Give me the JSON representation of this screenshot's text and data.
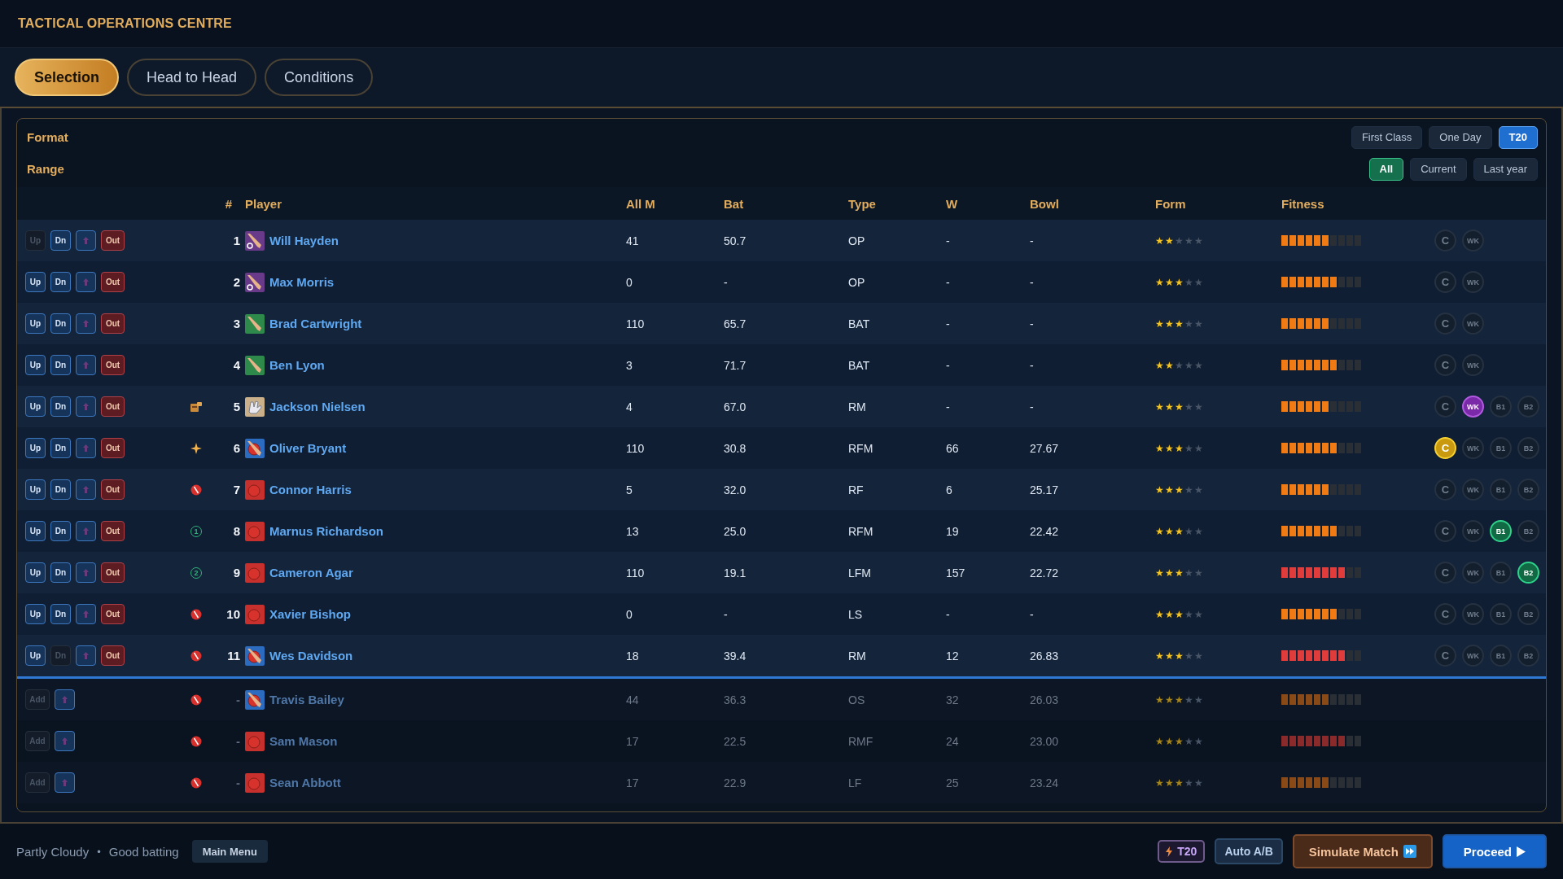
{
  "window": {
    "title": "TACTICAL OPERATIONS CENTRE"
  },
  "tabs": [
    {
      "label": "Selection",
      "selected": true
    },
    {
      "label": "Head to Head",
      "selected": false
    },
    {
      "label": "Conditions",
      "selected": false
    }
  ],
  "filters": [
    {
      "label": "Format",
      "options": [
        {
          "label": "First Class",
          "selected": false
        },
        {
          "label": "One Day",
          "selected": false
        },
        {
          "label": "T20",
          "selected": true
        }
      ],
      "kind": "format"
    },
    {
      "label": "Range",
      "options": [
        {
          "label": "All",
          "selected": true
        },
        {
          "label": "Current",
          "selected": false
        },
        {
          "label": "Last year",
          "selected": false
        }
      ],
      "kind": "range"
    }
  ],
  "table": {
    "columns": [
      "#",
      "Player",
      "All M",
      "Bat",
      "Type",
      "W",
      "Bowl",
      "Form",
      "Fitness"
    ],
    "rows": [
      {
        "kind": "playing",
        "controls": [
          {
            "kind": "up",
            "label": "Up",
            "disabled": true
          },
          {
            "kind": "down",
            "label": "Dn",
            "disabled": false
          },
          {
            "kind": "swap",
            "disabled": false
          },
          {
            "kind": "out",
            "label": "Out",
            "disabled": false
          }
        ],
        "number": "1",
        "role_icon": {
          "kind": "opener"
        },
        "name": "Will Hayden",
        "all_m": "41",
        "bat": "50.7",
        "type": "OP",
        "w": "-",
        "bowl": "-",
        "stars": 2,
        "level": 0.6,
        "roles": [
          {
            "kind": "captain",
            "label": "C",
            "selected": false
          },
          {
            "kind": "keeper",
            "label": "WK",
            "selected": false
          }
        ]
      },
      {
        "kind": "playing",
        "controls": [
          {
            "kind": "up",
            "label": "Up",
            "disabled": false
          },
          {
            "kind": "down",
            "label": "Dn",
            "disabled": false
          },
          {
            "kind": "swap",
            "disabled": false
          },
          {
            "kind": "out",
            "label": "Out",
            "disabled": false
          }
        ],
        "number": "2",
        "role_icon": {
          "kind": "opener"
        },
        "name": "Max Morris",
        "all_m": "0",
        "bat": "-",
        "type": "OP",
        "w": "-",
        "bowl": "-",
        "stars": 3,
        "level": 0.7,
        "roles": [
          {
            "kind": "captain",
            "label": "C",
            "selected": false
          },
          {
            "kind": "keeper",
            "label": "WK",
            "selected": false
          }
        ]
      },
      {
        "kind": "playing",
        "controls": [
          {
            "kind": "up",
            "label": "Up",
            "disabled": false
          },
          {
            "kind": "down",
            "label": "Dn",
            "disabled": false
          },
          {
            "kind": "swap",
            "disabled": false
          },
          {
            "kind": "out",
            "label": "Out",
            "disabled": false
          }
        ],
        "number": "3",
        "role_icon": {
          "kind": "batter"
        },
        "name": "Brad Cartwright",
        "all_m": "110",
        "bat": "65.7",
        "type": "BAT",
        "w": "-",
        "bowl": "-",
        "stars": 3,
        "level": 0.6,
        "roles": [
          {
            "kind": "captain",
            "label": "C",
            "selected": false
          },
          {
            "kind": "keeper",
            "label": "WK",
            "selected": false
          }
        ]
      },
      {
        "kind": "playing",
        "controls": [
          {
            "kind": "up",
            "label": "Up",
            "disabled": false
          },
          {
            "kind": "down",
            "label": "Dn",
            "disabled": false
          },
          {
            "kind": "swap",
            "disabled": false
          },
          {
            "kind": "out",
            "label": "Out",
            "disabled": false
          }
        ],
        "number": "4",
        "role_icon": {
          "kind": "batter"
        },
        "name": "Ben Lyon",
        "all_m": "3",
        "bat": "71.7",
        "type": "BAT",
        "w": "-",
        "bowl": "-",
        "stars": 2,
        "level": 0.7,
        "roles": [
          {
            "kind": "captain",
            "label": "C",
            "selected": false
          },
          {
            "kind": "keeper",
            "label": "WK",
            "selected": false
          }
        ]
      },
      {
        "kind": "playing",
        "controls": [
          {
            "kind": "up",
            "label": "Up",
            "disabled": false
          },
          {
            "kind": "down",
            "label": "Dn",
            "disabled": false
          },
          {
            "kind": "swap",
            "disabled": false
          },
          {
            "kind": "out",
            "label": "Out",
            "disabled": false
          }
        ],
        "marker": {
          "kind": "gloves"
        },
        "number": "5",
        "role_icon": {
          "kind": "keeper"
        },
        "name": "Jackson Nielsen",
        "all_m": "4",
        "bat": "67.0",
        "type": "RM",
        "w": "-",
        "bowl": "-",
        "stars": 3,
        "level": 0.6,
        "roles": [
          {
            "kind": "captain",
            "label": "C",
            "selected": false
          },
          {
            "kind": "keeper",
            "label": "WK",
            "selected": true
          },
          {
            "kind": "bowler",
            "label": "B1",
            "selected": false
          },
          {
            "kind": "bowler",
            "label": "B2",
            "selected": false
          }
        ]
      },
      {
        "kind": "playing",
        "controls": [
          {
            "kind": "up",
            "label": "Up",
            "disabled": false
          },
          {
            "kind": "down",
            "label": "Dn",
            "disabled": false
          },
          {
            "kind": "swap",
            "disabled": false
          },
          {
            "kind": "out",
            "label": "Out",
            "disabled": false
          }
        ],
        "marker": {
          "kind": "spark"
        },
        "number": "6",
        "role_icon": {
          "kind": "allrounder"
        },
        "name": "Oliver Bryant",
        "all_m": "110",
        "bat": "30.8",
        "type": "RFM",
        "w": "66",
        "bowl": "27.67",
        "stars": 3,
        "level": 0.7,
        "roles": [
          {
            "kind": "captain",
            "label": "C",
            "selected": true
          },
          {
            "kind": "keeper",
            "label": "WK",
            "selected": false
          },
          {
            "kind": "bowler",
            "label": "B1",
            "selected": false
          },
          {
            "kind": "bowler",
            "label": "B2",
            "selected": false
          }
        ]
      },
      {
        "kind": "playing",
        "controls": [
          {
            "kind": "up",
            "label": "Up",
            "disabled": false
          },
          {
            "kind": "down",
            "label": "Dn",
            "disabled": false
          },
          {
            "kind": "swap",
            "disabled": false
          },
          {
            "kind": "out",
            "label": "Out",
            "disabled": false
          }
        ],
        "marker": {
          "kind": "ball"
        },
        "number": "7",
        "role_icon": {
          "kind": "bowler"
        },
        "name": "Connor Harris",
        "all_m": "5",
        "bat": "32.0",
        "type": "RF",
        "w": "6",
        "bowl": "25.17",
        "stars": 3,
        "level": 0.6,
        "roles": [
          {
            "kind": "captain",
            "label": "C",
            "selected": false
          },
          {
            "kind": "keeper",
            "label": "WK",
            "selected": false
          },
          {
            "kind": "bowler",
            "label": "B1",
            "selected": false
          },
          {
            "kind": "bowler",
            "label": "B2",
            "selected": false
          }
        ]
      },
      {
        "kind": "playing",
        "controls": [
          {
            "kind": "up",
            "label": "Up",
            "disabled": false
          },
          {
            "kind": "down",
            "label": "Dn",
            "disabled": false
          },
          {
            "kind": "swap",
            "disabled": false
          },
          {
            "kind": "out",
            "label": "Out",
            "disabled": false
          }
        ],
        "marker": {
          "kind": "order",
          "label": "1"
        },
        "number": "8",
        "role_icon": {
          "kind": "bowler"
        },
        "name": "Marnus Richardson",
        "all_m": "13",
        "bat": "25.0",
        "type": "RFM",
        "w": "19",
        "bowl": "22.42",
        "stars": 3,
        "level": 0.7,
        "roles": [
          {
            "kind": "captain",
            "label": "C",
            "selected": false
          },
          {
            "kind": "keeper",
            "label": "WK",
            "selected": false
          },
          {
            "kind": "bowler",
            "label": "B1",
            "selected": true
          },
          {
            "kind": "bowler",
            "label": "B2",
            "selected": false
          }
        ]
      },
      {
        "kind": "playing",
        "controls": [
          {
            "kind": "up",
            "label": "Up",
            "disabled": false
          },
          {
            "kind": "down",
            "label": "Dn",
            "disabled": false
          },
          {
            "kind": "swap",
            "disabled": false
          },
          {
            "kind": "out",
            "label": "Out",
            "disabled": false
          }
        ],
        "marker": {
          "kind": "order",
          "label": "2"
        },
        "number": "9",
        "role_icon": {
          "kind": "bowler"
        },
        "name": "Cameron Agar",
        "all_m": "110",
        "bat": "19.1",
        "type": "LFM",
        "w": "157",
        "bowl": "22.72",
        "stars": 3,
        "level": 0.8,
        "roles": [
          {
            "kind": "captain",
            "label": "C",
            "selected": false
          },
          {
            "kind": "keeper",
            "label": "WK",
            "selected": false
          },
          {
            "kind": "bowler",
            "label": "B1",
            "selected": false
          },
          {
            "kind": "bowler",
            "label": "B2",
            "selected": true
          }
        ]
      },
      {
        "kind": "playing",
        "controls": [
          {
            "kind": "up",
            "label": "Up",
            "disabled": false
          },
          {
            "kind": "down",
            "label": "Dn",
            "disabled": false
          },
          {
            "kind": "swap",
            "disabled": false
          },
          {
            "kind": "out",
            "label": "Out",
            "disabled": false
          }
        ],
        "marker": {
          "kind": "ball"
        },
        "number": "10",
        "role_icon": {
          "kind": "bowler"
        },
        "name": "Xavier Bishop",
        "all_m": "0",
        "bat": "-",
        "type": "LS",
        "w": "-",
        "bowl": "-",
        "stars": 3,
        "level": 0.7,
        "roles": [
          {
            "kind": "captain",
            "label": "C",
            "selected": false
          },
          {
            "kind": "keeper",
            "label": "WK",
            "selected": false
          },
          {
            "kind": "bowler",
            "label": "B1",
            "selected": false
          },
          {
            "kind": "bowler",
            "label": "B2",
            "selected": false
          }
        ]
      },
      {
        "kind": "playing",
        "controls": [
          {
            "kind": "up",
            "label": "Up",
            "disabled": false
          },
          {
            "kind": "down",
            "label": "Dn",
            "disabled": true
          },
          {
            "kind": "swap",
            "disabled": false
          },
          {
            "kind": "out",
            "label": "Out",
            "disabled": false
          }
        ],
        "marker": {
          "kind": "ball"
        },
        "number": "11",
        "role_icon": {
          "kind": "allrounder"
        },
        "name": "Wes Davidson",
        "all_m": "18",
        "bat": "39.4",
        "type": "RM",
        "w": "12",
        "bowl": "26.83",
        "stars": 3,
        "level": 0.8,
        "roles": [
          {
            "kind": "captain",
            "label": "C",
            "selected": false
          },
          {
            "kind": "keeper",
            "label": "WK",
            "selected": false
          },
          {
            "kind": "bowler",
            "label": "B1",
            "selected": false
          },
          {
            "kind": "bowler",
            "label": "B2",
            "selected": false
          }
        ]
      },
      {
        "kind": "bench",
        "controls": [
          {
            "kind": "add",
            "label": "Add",
            "disabled": true
          },
          {
            "kind": "swap",
            "disabled": false
          }
        ],
        "marker": {
          "kind": "ball"
        },
        "number": "-",
        "role_icon": {
          "kind": "allrounder"
        },
        "name": "Travis Bailey",
        "all_m": "44",
        "bat": "36.3",
        "type": "OS",
        "w": "32",
        "bowl": "26.03",
        "stars": 3,
        "level": 0.6
      },
      {
        "kind": "bench",
        "controls": [
          {
            "kind": "add",
            "label": "Add",
            "disabled": true
          },
          {
            "kind": "swap",
            "disabled": false
          }
        ],
        "marker": {
          "kind": "ball"
        },
        "number": "-",
        "role_icon": {
          "kind": "bowler"
        },
        "name": "Sam Mason",
        "all_m": "17",
        "bat": "22.5",
        "type": "RMF",
        "w": "24",
        "bowl": "23.00",
        "stars": 3,
        "level": 0.8
      },
      {
        "kind": "bench",
        "controls": [
          {
            "kind": "add",
            "label": "Add",
            "disabled": true
          },
          {
            "kind": "swap",
            "disabled": false
          }
        ],
        "marker": {
          "kind": "ball"
        },
        "number": "-",
        "role_icon": {
          "kind": "bowler"
        },
        "name": "Sean Abbott",
        "all_m": "17",
        "bat": "22.9",
        "type": "LF",
        "w": "25",
        "bowl": "23.24",
        "stars": 3,
        "level": 0.6
      }
    ]
  },
  "status_bar": {
    "conditions": [
      "Partly Cloudy",
      "Good batting"
    ],
    "separator": "•",
    "menu_button": "Main Menu",
    "actions": [
      {
        "kind": "badge",
        "label": "T20"
      },
      {
        "kind": "auto",
        "label": "Auto A/B"
      },
      {
        "kind": "simulate",
        "label": "Simulate Match"
      },
      {
        "kind": "proceed",
        "label": "Proceed"
      }
    ]
  }
}
